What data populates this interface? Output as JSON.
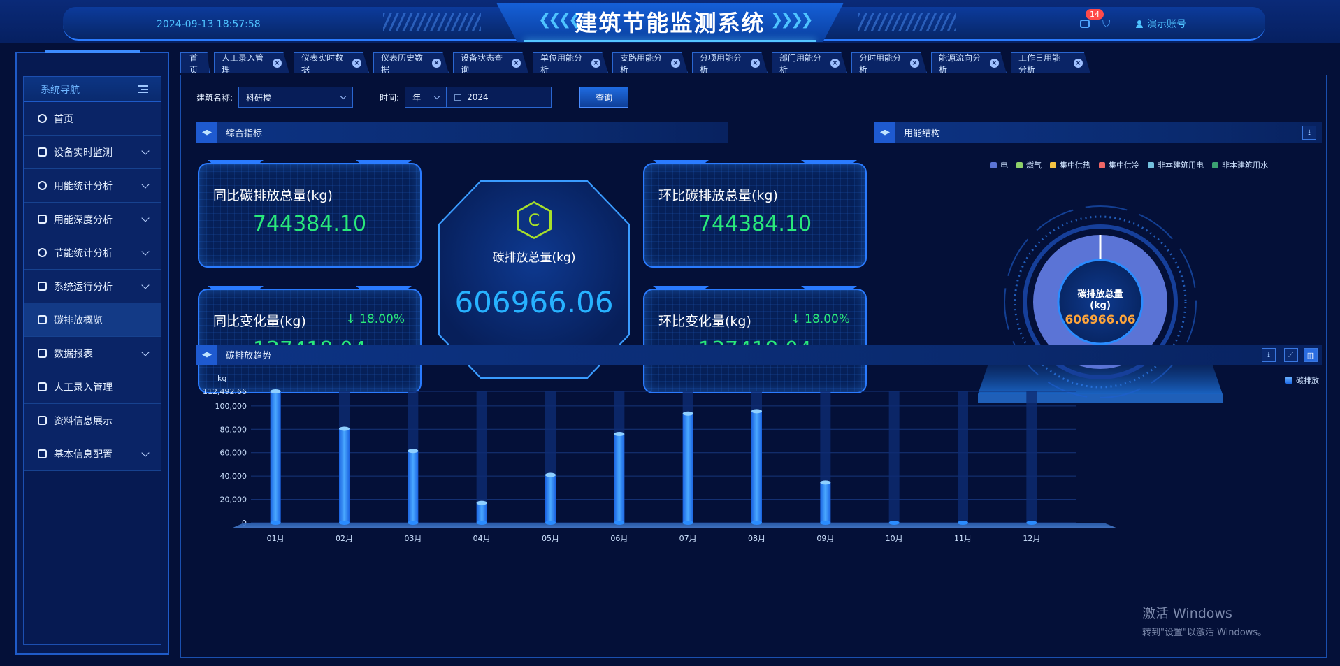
{
  "header": {
    "datetime": "2024-09-13 18:57:58",
    "title": "建筑节能监测系统",
    "message_count": "14",
    "user_name": "演示账号"
  },
  "sidebar": {
    "title": "系统导航",
    "items": [
      {
        "label": "首页",
        "icon": "dashboard-icon",
        "has_children": false
      },
      {
        "label": "设备实时监测",
        "icon": "monitor-icon",
        "has_children": true
      },
      {
        "label": "用能统计分析",
        "icon": "target-icon",
        "has_children": true
      },
      {
        "label": "用能深度分析",
        "icon": "image-icon",
        "has_children": true
      },
      {
        "label": "节能统计分析",
        "icon": "globe-icon",
        "has_children": true
      },
      {
        "label": "系统运行分析",
        "icon": "monitor-icon",
        "has_children": true
      },
      {
        "label": "碳排放概览",
        "icon": "numbers-icon",
        "has_children": false
      },
      {
        "label": "数据报表",
        "icon": "report-icon",
        "has_children": true
      },
      {
        "label": "人工录入管理",
        "icon": "edit-icon",
        "has_children": false
      },
      {
        "label": "资料信息展示",
        "icon": "card-icon",
        "has_children": false
      },
      {
        "label": "基本信息配置",
        "icon": "config-icon",
        "has_children": true
      }
    ]
  },
  "tabs": [
    {
      "label": "首页",
      "closable": false
    },
    {
      "label": "人工录入管理",
      "closable": true
    },
    {
      "label": "仪表实时数据",
      "closable": true
    },
    {
      "label": "仪表历史数据",
      "closable": true
    },
    {
      "label": "设备状态查询",
      "closable": true
    },
    {
      "label": "单位用能分析",
      "closable": true
    },
    {
      "label": "支路用能分析",
      "closable": true
    },
    {
      "label": "分项用能分析",
      "closable": true
    },
    {
      "label": "部门用能分析",
      "closable": true
    },
    {
      "label": "分时用能分析",
      "closable": true
    },
    {
      "label": "能源流向分析",
      "closable": true
    },
    {
      "label": "工作日用能分析",
      "closable": true
    }
  ],
  "filters": {
    "building_label": "建筑名称:",
    "building_value": "科研楼",
    "time_label": "时间:",
    "period_value": "年",
    "date_value": "2024",
    "query_label": "查询"
  },
  "overview": {
    "title": "综合指标",
    "yoy_total_label": "同比碳排放总量(kg)",
    "yoy_total_value": "744384.10",
    "mom_total_label": "环比碳排放总量(kg)",
    "mom_total_value": "744384.10",
    "yoy_change_label": "同比变化量(kg)",
    "yoy_change_value": "137418.04",
    "yoy_change_pct": "↓ 18.00%",
    "mom_change_label": "环比变化量(kg)",
    "mom_change_value": "137418.04",
    "mom_change_pct": "↓ 18.00%",
    "center_icon_text": "C",
    "center_label": "碳排放总量(kg)",
    "center_value": "606966.06"
  },
  "structure": {
    "title": "用能结构",
    "legend": [
      {
        "name": "电",
        "color": "#5b74d6"
      },
      {
        "name": "燃气",
        "color": "#8fd16a"
      },
      {
        "name": "集中供热",
        "color": "#f5c342"
      },
      {
        "name": "集中供冷",
        "color": "#ee6666"
      },
      {
        "name": "非本建筑用电",
        "color": "#73c0de"
      },
      {
        "name": "非本建筑用水",
        "color": "#3ba272"
      }
    ],
    "center_label_1": "碳排放总量",
    "center_label_2": "(kg)",
    "center_value": "606966.06"
  },
  "trend": {
    "title": "碳排放趋势",
    "legend_label": "碳排放",
    "unit_label": "kg"
  },
  "chart_data": {
    "type": "bar",
    "categories": [
      "01月",
      "02月",
      "03月",
      "04月",
      "05月",
      "06月",
      "07月",
      "08月",
      "09月",
      "10月",
      "11月",
      "12月"
    ],
    "series": [
      {
        "name": "碳排放",
        "values": [
          112492.66,
          80500,
          61500,
          17000,
          41000,
          76000,
          93500,
          95500,
          34500,
          0,
          0,
          0
        ]
      }
    ],
    "ylabel": "kg",
    "ylim": [
      0,
      112492.66
    ],
    "yticks": [
      "0",
      "20,000",
      "40,000",
      "60,000",
      "80,000",
      "100,000",
      "112,492.66"
    ],
    "ytick_values": [
      0,
      20000,
      40000,
      60000,
      80000,
      100000,
      112492.66
    ],
    "grid": true,
    "legend_position": "top-right"
  },
  "watermark": {
    "line1": "激活 Windows",
    "line2": "转到\"设置\"以激活 Windows。"
  }
}
